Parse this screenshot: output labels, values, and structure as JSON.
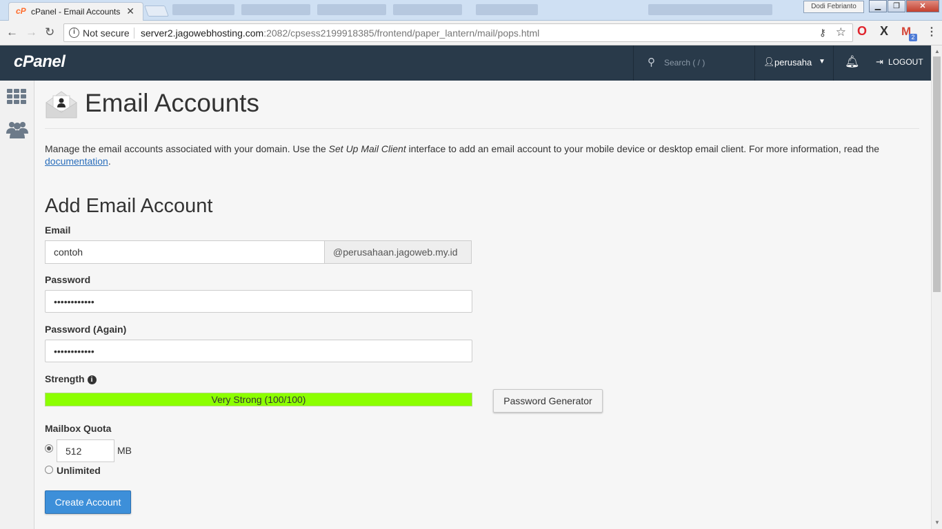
{
  "browser": {
    "tab_title": "cPanel - Email Accounts",
    "tab_favicon": "cP",
    "window_user": "Dodi Febrianto",
    "security_label": "Not secure",
    "url_host": "server2.jagowebhosting.com",
    "url_path": ":2082/cpsess2199918385/frontend/paper_lantern/mail/pops.html",
    "extension_badge": "2"
  },
  "header": {
    "logo": "cPanel",
    "search_placeholder": "Search ( / )",
    "username": "perusaha",
    "logout_label": "LOGOUT"
  },
  "page": {
    "title": "Email Accounts",
    "intro_1": "Manage the email accounts associated with your domain. Use the ",
    "intro_em": "Set Up Mail Client",
    "intro_2": " interface to add an email account to your mobile device or desktop email client. For more information, read the ",
    "intro_link": "documentation",
    "intro_end": "."
  },
  "form": {
    "section_title": "Add Email Account",
    "email_label": "Email",
    "email_value": "contoh",
    "email_domain": "@perusahaan.jagoweb.my.id",
    "password_label": "Password",
    "password_value": "••••••••••••",
    "password_again_label": "Password (Again)",
    "password_again_value": "••••••••••••",
    "strength_label": "Strength",
    "strength_text": "Very Strong (100/100)",
    "strength_score": 100,
    "generator_label": "Password Generator",
    "quota_label": "Mailbox Quota",
    "quota_value": "512",
    "quota_unit": "MB",
    "unlimited_label": "Unlimited",
    "create_label": "Create Account"
  },
  "colors": {
    "header_bg": "#293a4a",
    "strength_bar": "#8cff00",
    "primary_button": "#3d8fd9",
    "link": "#2a6ebb"
  }
}
